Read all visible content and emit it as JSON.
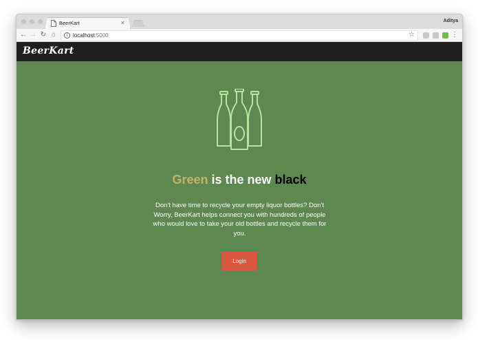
{
  "browser": {
    "tab": {
      "title": "BeerKart",
      "close_label": "×",
      "icon": "page-icon"
    },
    "profile_name": "Aditya",
    "nav": {
      "back_icon": "←",
      "forward_icon": "→",
      "reload_icon": "↻",
      "home_icon": "⌂"
    },
    "address": {
      "host": "localhost",
      "port": ":5000",
      "info_icon": "i",
      "bookmark_icon": "☆"
    },
    "menu_icon": "⋮",
    "extension_colors": [
      "#bfbfbf",
      "#bfbfbf",
      "#6cbf3f"
    ]
  },
  "site": {
    "brand": "BeerKart",
    "hero": {
      "icon": "beer-bottles-icon",
      "headline": {
        "green": "Green",
        "middle": " is the new ",
        "black": "black"
      },
      "description": "Don't have time to recycle your empty liquor bottles? Don't Worry, BeerKart helps connect you with hundreds of people who would love to take your old bottles and recycle them for you.",
      "login_label": "Login"
    }
  },
  "colors": {
    "hero_background": "#5e8752",
    "navbar_background": "#1f1f1f",
    "accent_green_text": "#c2b36e",
    "bottle_stroke": "#b5e6a1",
    "login_button": "#d9573f"
  }
}
